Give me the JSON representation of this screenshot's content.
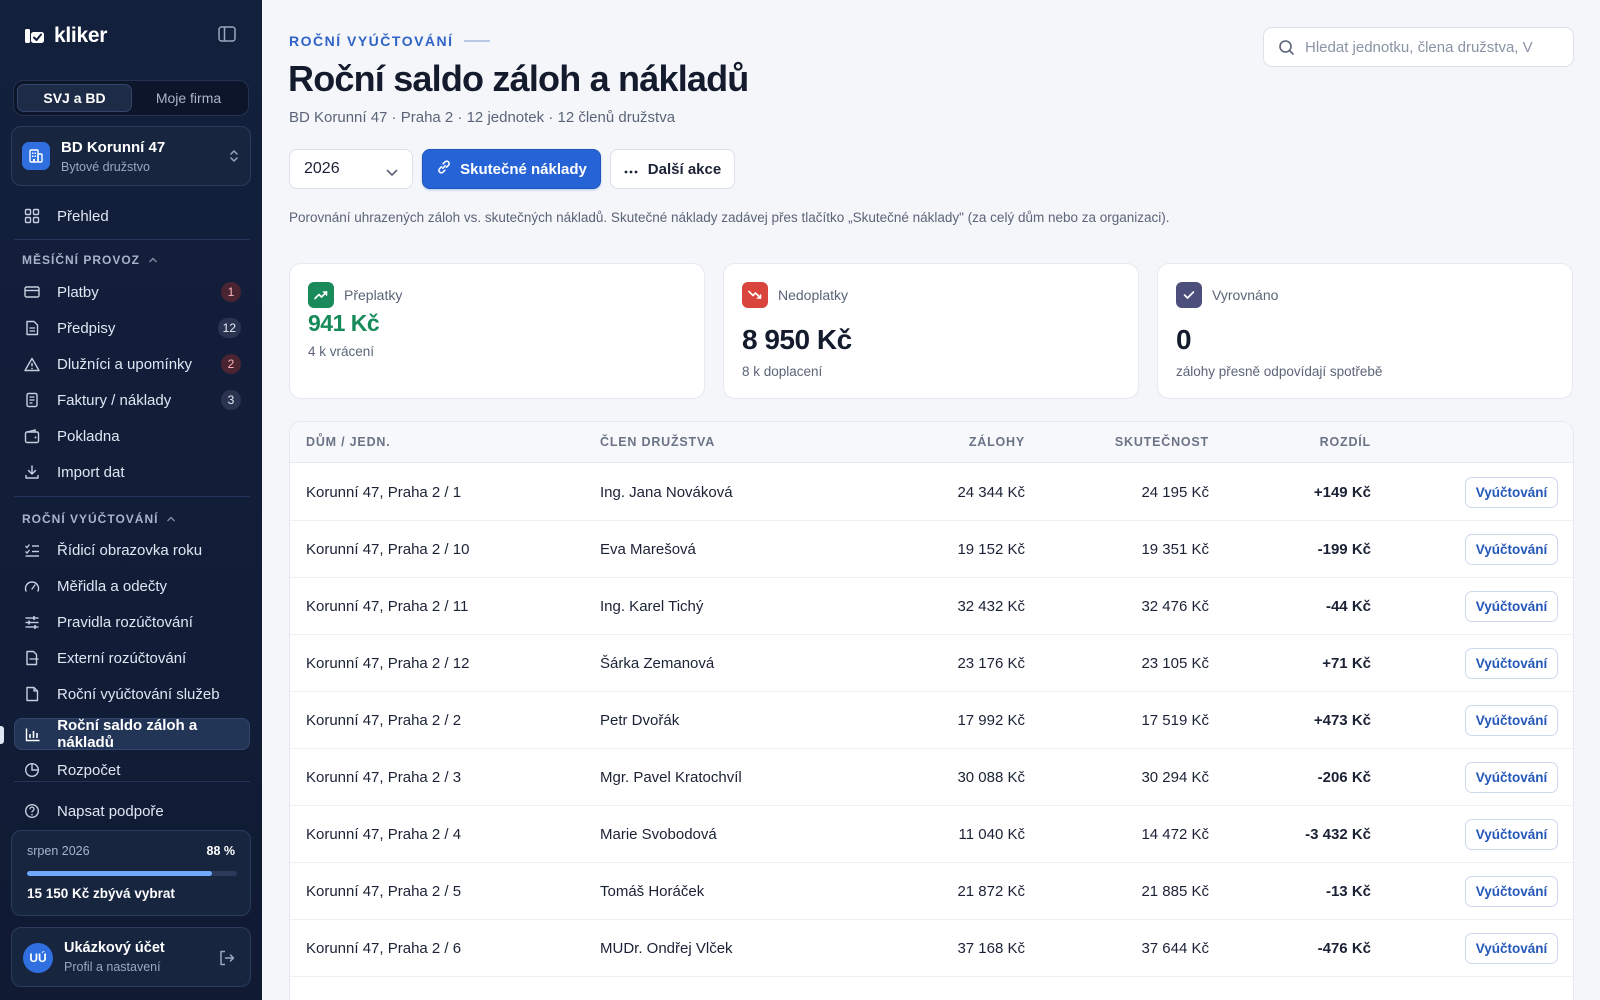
{
  "app": {
    "name": "kliker"
  },
  "sidebar": {
    "segments": [
      "SVJ a BD",
      "Moje firma"
    ],
    "org": {
      "name": "BD Korunní 47",
      "type": "Bytové družstvo"
    },
    "overview": "Přehled",
    "section_monthly": "MĚSÍČNÍ PROVOZ",
    "monthly_items": [
      {
        "label": "Platby",
        "badge": "1"
      },
      {
        "label": "Předpisy",
        "badge": "12"
      },
      {
        "label": "Dlužníci a upomínky",
        "badge": "2"
      },
      {
        "label": "Faktury / náklady",
        "badge": "3"
      },
      {
        "label": "Pokladna"
      },
      {
        "label": "Import dat"
      }
    ],
    "section_annual": "ROČNÍ VYÚČTOVÁNÍ",
    "annual_items": [
      {
        "label": "Řídicí obrazovka roku"
      },
      {
        "label": "Měřidla a odečty"
      },
      {
        "label": "Pravidla rozúčtování"
      },
      {
        "label": "Externí rozúčtování"
      },
      {
        "label": "Roční vyúčtování služeb"
      },
      {
        "label": "Roční saldo záloh a nákladů"
      },
      {
        "label": "Rozpočet"
      }
    ],
    "support": "Napsat podpoře",
    "progress": {
      "month": "srpen 2026",
      "percent_label": "88 %",
      "fraction": 0.88,
      "remaining": "15 150 Kč zbývá vybrat"
    },
    "user": {
      "initials": "UÚ",
      "name": "Ukázkový účet",
      "sub": "Profil a nastavení"
    }
  },
  "header": {
    "eyebrow": "ROČNÍ VYÚČTOVÁNÍ",
    "title": "Roční saldo záloh a nákladů",
    "subtitle": "BD Korunní 47 · Praha 2 · 12 jednotek · 12 členů družstva",
    "search_placeholder": "Hledat jednotku, člena družstva, V"
  },
  "toolbar": {
    "year": "2026",
    "primary": "Skutečné náklady",
    "secondary": "Další akce"
  },
  "description": "Porovnání uhrazených záloh vs. skutečných nákladů. Skutečné náklady zadávej přes tlačítko „Skutečné náklady\" (za celý dům nebo za organizaci).",
  "cards": {
    "overpay": {
      "label": "Přeplatky",
      "value": "941 Kč",
      "sub": "4 k vrácení"
    },
    "underpay": {
      "label": "Nedoplatky",
      "value": "8 950 Kč",
      "sub": "8 k doplacení"
    },
    "balanced": {
      "label": "Vyrovnáno",
      "value": "0",
      "sub": "zálohy přesně odpovídají spotřebě"
    }
  },
  "colors": {
    "accent": "#2563d6",
    "positive": "#178a5a",
    "negative": "#d9453c",
    "neutral": "#4b4f7a"
  },
  "table": {
    "headers": {
      "unit": "DŮM / JEDN.",
      "member": "ČLEN DRUŽSTVA",
      "deposits": "ZÁLOHY",
      "actual": "SKUTEČNOST",
      "diff": "ROZDÍL"
    },
    "action_label": "Vyúčtování",
    "rows": [
      {
        "unit": "Korunní 47, Praha 2 / 1",
        "member": "Ing. Jana Nováková",
        "deposits": "24 344 Kč",
        "actual": "24 195 Kč",
        "diff": "+149 Kč"
      },
      {
        "unit": "Korunní 47, Praha 2 / 10",
        "member": "Eva Marešová",
        "deposits": "19 152 Kč",
        "actual": "19 351 Kč",
        "diff": "-199 Kč"
      },
      {
        "unit": "Korunní 47, Praha 2 / 11",
        "member": "Ing. Karel Tichý",
        "deposits": "32 432 Kč",
        "actual": "32 476 Kč",
        "diff": "-44 Kč"
      },
      {
        "unit": "Korunní 47, Praha 2 / 12",
        "member": "Šárka Zemanová",
        "deposits": "23 176 Kč",
        "actual": "23 105 Kč",
        "diff": "+71 Kč"
      },
      {
        "unit": "Korunní 47, Praha 2 / 2",
        "member": "Petr Dvořák",
        "deposits": "17 992 Kč",
        "actual": "17 519 Kč",
        "diff": "+473 Kč"
      },
      {
        "unit": "Korunní 47, Praha 2 / 3",
        "member": "Mgr. Pavel Kratochvíl",
        "deposits": "30 088 Kč",
        "actual": "30 294 Kč",
        "diff": "-206 Kč"
      },
      {
        "unit": "Korunní 47, Praha 2 / 4",
        "member": "Marie Svobodová",
        "deposits": "11 040 Kč",
        "actual": "14 472 Kč",
        "diff": "-3 432 Kč"
      },
      {
        "unit": "Korunní 47, Praha 2 / 5",
        "member": "Tomáš Horáček",
        "deposits": "21 872 Kč",
        "actual": "21 885 Kč",
        "diff": "-13 Kč"
      },
      {
        "unit": "Korunní 47, Praha 2 / 6",
        "member": "MUDr. Ondřej Vlček",
        "deposits": "37 168 Kč",
        "actual": "37 644 Kč",
        "diff": "-476 Kč"
      }
    ]
  }
}
